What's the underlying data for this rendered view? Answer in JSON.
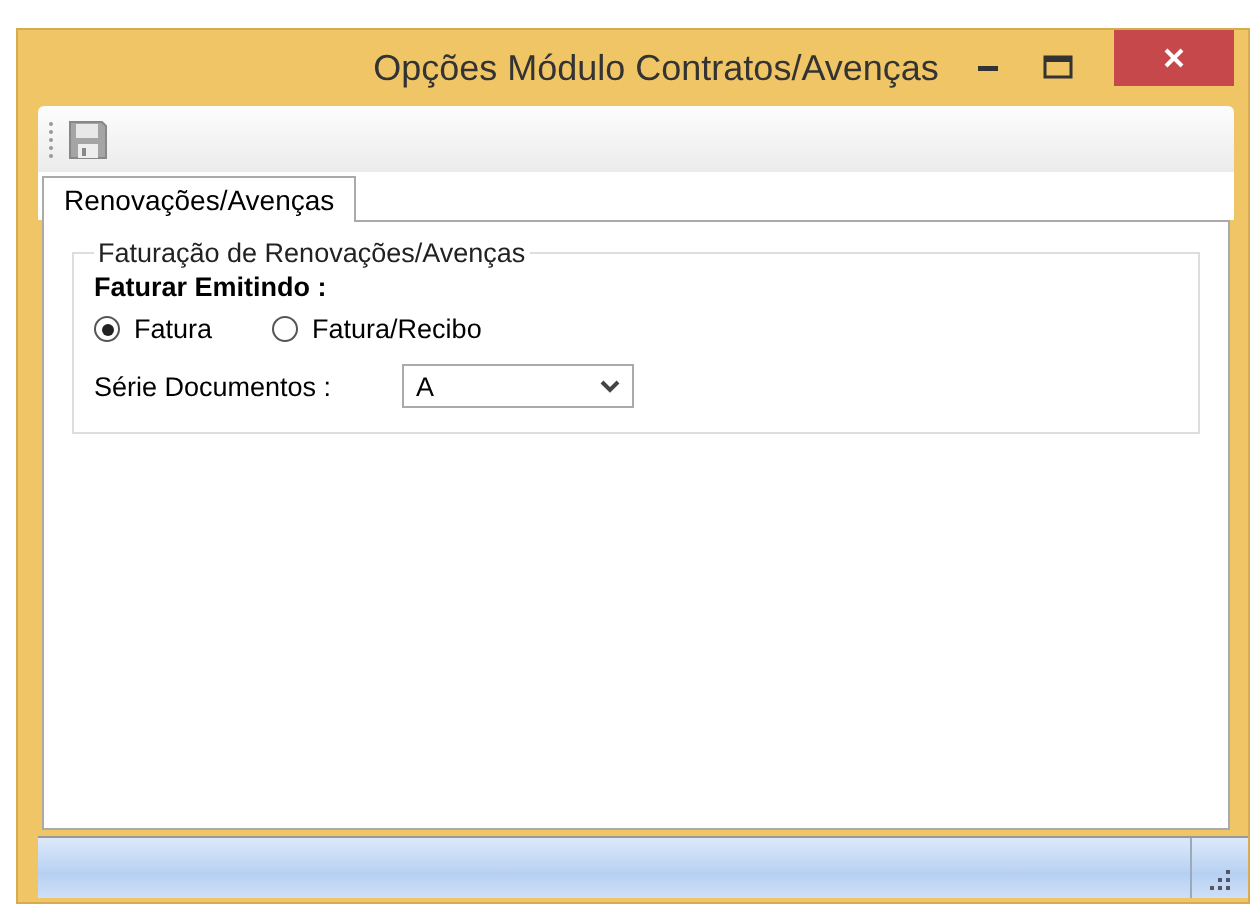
{
  "window": {
    "title": "Opções Módulo Contratos/Avenças"
  },
  "tabs": [
    {
      "label": "Renovações/Avenças",
      "selected": true
    }
  ],
  "group": {
    "title": "Faturação de Renovações/Avenças",
    "heading": "Faturar Emitindo :",
    "radios": [
      {
        "label": "Fatura",
        "selected": true
      },
      {
        "label": "Fatura/Recibo",
        "selected": false
      }
    ],
    "series": {
      "label": "Série Documentos :",
      "value": "A"
    }
  }
}
